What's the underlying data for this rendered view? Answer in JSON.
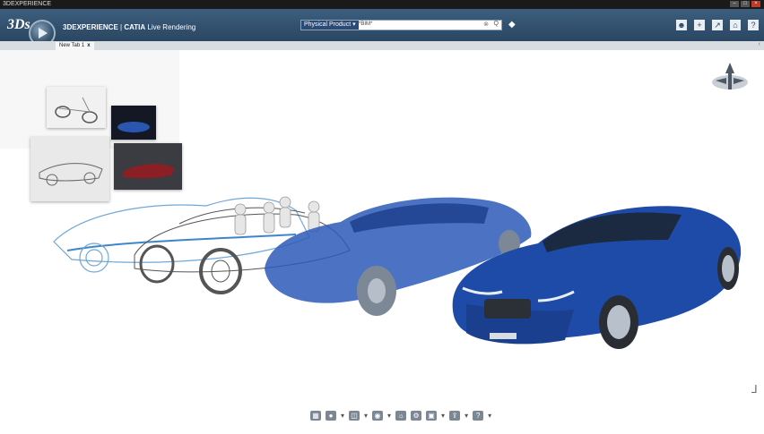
{
  "window": {
    "app_label": "3DEXPERIENCE",
    "controls": [
      "–",
      "□",
      "×"
    ]
  },
  "header": {
    "logo": "3Ds",
    "brand_prefix": "3DEXPERIENCE",
    "brand_separator": " | ",
    "brand_app": "CATIA",
    "brand_suffix": " Live Rendering",
    "search": {
      "filter": "Physical Product",
      "query": "*BIM*",
      "clear_glyph": "⊗",
      "go_glyph": "Q"
    },
    "icons": [
      "user-icon",
      "add-icon",
      "share-icon",
      "home-icon",
      "help-icon"
    ]
  },
  "tabs": [
    {
      "label": "New Tab 1",
      "close": "x"
    }
  ],
  "toolbar": {
    "icons": [
      "render-icon",
      "material-icon",
      "camera-icon",
      "snapshot-icon",
      "light-icon",
      "settings-icon",
      "image-icon",
      "export-icon",
      "help-icon"
    ]
  },
  "colors": {
    "header_bg": "#2a4662",
    "car_blue": "#1e4aa8",
    "tab_bg": "#d8dde2"
  }
}
